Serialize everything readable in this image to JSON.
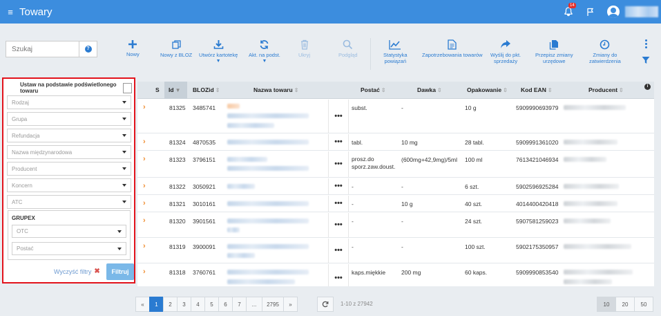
{
  "header": {
    "title": "Towary",
    "notifications": "14",
    "menu_icon": "≡"
  },
  "search": {
    "placeholder": "Szukaj"
  },
  "toolbar": {
    "nowy": "Nowy",
    "nowy_z_bloz": "Nowy z BLOZ",
    "utworz": "Utwórz kartotekę",
    "akt": "Akt. na podst.",
    "ukryj": "Ukryj",
    "podglad": "Podgląd",
    "statystyka1": "Statystyka",
    "statystyka2": "powiązań",
    "zapotrzebowania": "Zapotrzebowania towarów",
    "wyslij1": "Wyślij do pkt.",
    "wyslij2": "sprzedaży",
    "przepisz1": "Przepisz zmiany",
    "przepisz2": "urzędowe",
    "zmiany1": "Zmiany do",
    "zmiany2": "zatwierdzenia"
  },
  "filters": {
    "highlight_label": "Ustaw na podstawie podświetlonego towaru",
    "selects": [
      "Rodzaj",
      "Grupa",
      "Refundacja",
      "Nazwa międzynarodowa",
      "Producent",
      "Koncern",
      "ATC"
    ],
    "grupex_title": "GRUPEX",
    "grupex_selects": [
      "OTC",
      "Postać"
    ],
    "clear_label": "Wyczyść filtry",
    "filter_label": "Filtruj"
  },
  "table": {
    "columns": {
      "s": "S",
      "id": "Id",
      "bloz": "BLOZid",
      "nazwa": "Nazwa towaru",
      "postac": "Postać",
      "dawka": "Dawka",
      "opakowanie": "Opakowanie",
      "ean": "Kod EAN",
      "producent": "Producent"
    },
    "rows": [
      {
        "id": "81325",
        "bloz": "3485741",
        "postac": "subst.",
        "dawka": "-",
        "opakowanie": "10 g",
        "ean": "5909990693979"
      },
      {
        "id": "81324",
        "bloz": "4870535",
        "postac": "tabl.",
        "dawka": "10 mg",
        "opakowanie": "28 tabl.",
        "ean": "5909991361020"
      },
      {
        "id": "81323",
        "bloz": "3796151",
        "postac": "prosz.do sporz.zaw.doust.",
        "dawka": "(600mg+42,9mg)/5ml",
        "opakowanie": "100 ml",
        "ean": "7613421046934"
      },
      {
        "id": "81322",
        "bloz": "3050921",
        "postac": "-",
        "dawka": "-",
        "opakowanie": "6 szt.",
        "ean": "5902596925284"
      },
      {
        "id": "81321",
        "bloz": "3010161",
        "postac": "-",
        "dawka": "10 g",
        "opakowanie": "40 szt.",
        "ean": "4014400420418"
      },
      {
        "id": "81320",
        "bloz": "3901561",
        "postac": "-",
        "dawka": "-",
        "opakowanie": "24 szt.",
        "ean": "5907581259023"
      },
      {
        "id": "81319",
        "bloz": "3900091",
        "postac": "-",
        "dawka": "-",
        "opakowanie": "100 szt.",
        "ean": "5902175350957"
      },
      {
        "id": "81318",
        "bloz": "3760761",
        "postac": "kaps.miękkie",
        "dawka": "200 mg",
        "opakowanie": "60 kaps.",
        "ean": "5909990853540"
      }
    ],
    "more": "•••"
  },
  "pagination": {
    "prev": "«",
    "next": "»",
    "pages": [
      "1",
      "2",
      "3",
      "4",
      "5",
      "6",
      "7",
      "...",
      "2795"
    ],
    "range": "1-10 z 27942",
    "page_sizes": [
      "10",
      "20",
      "50"
    ]
  },
  "colors": {
    "header": "#3c8dde",
    "accent": "#2a7bd1",
    "highlight_border": "#e2121b",
    "row_arrow": "#f08c2e"
  }
}
